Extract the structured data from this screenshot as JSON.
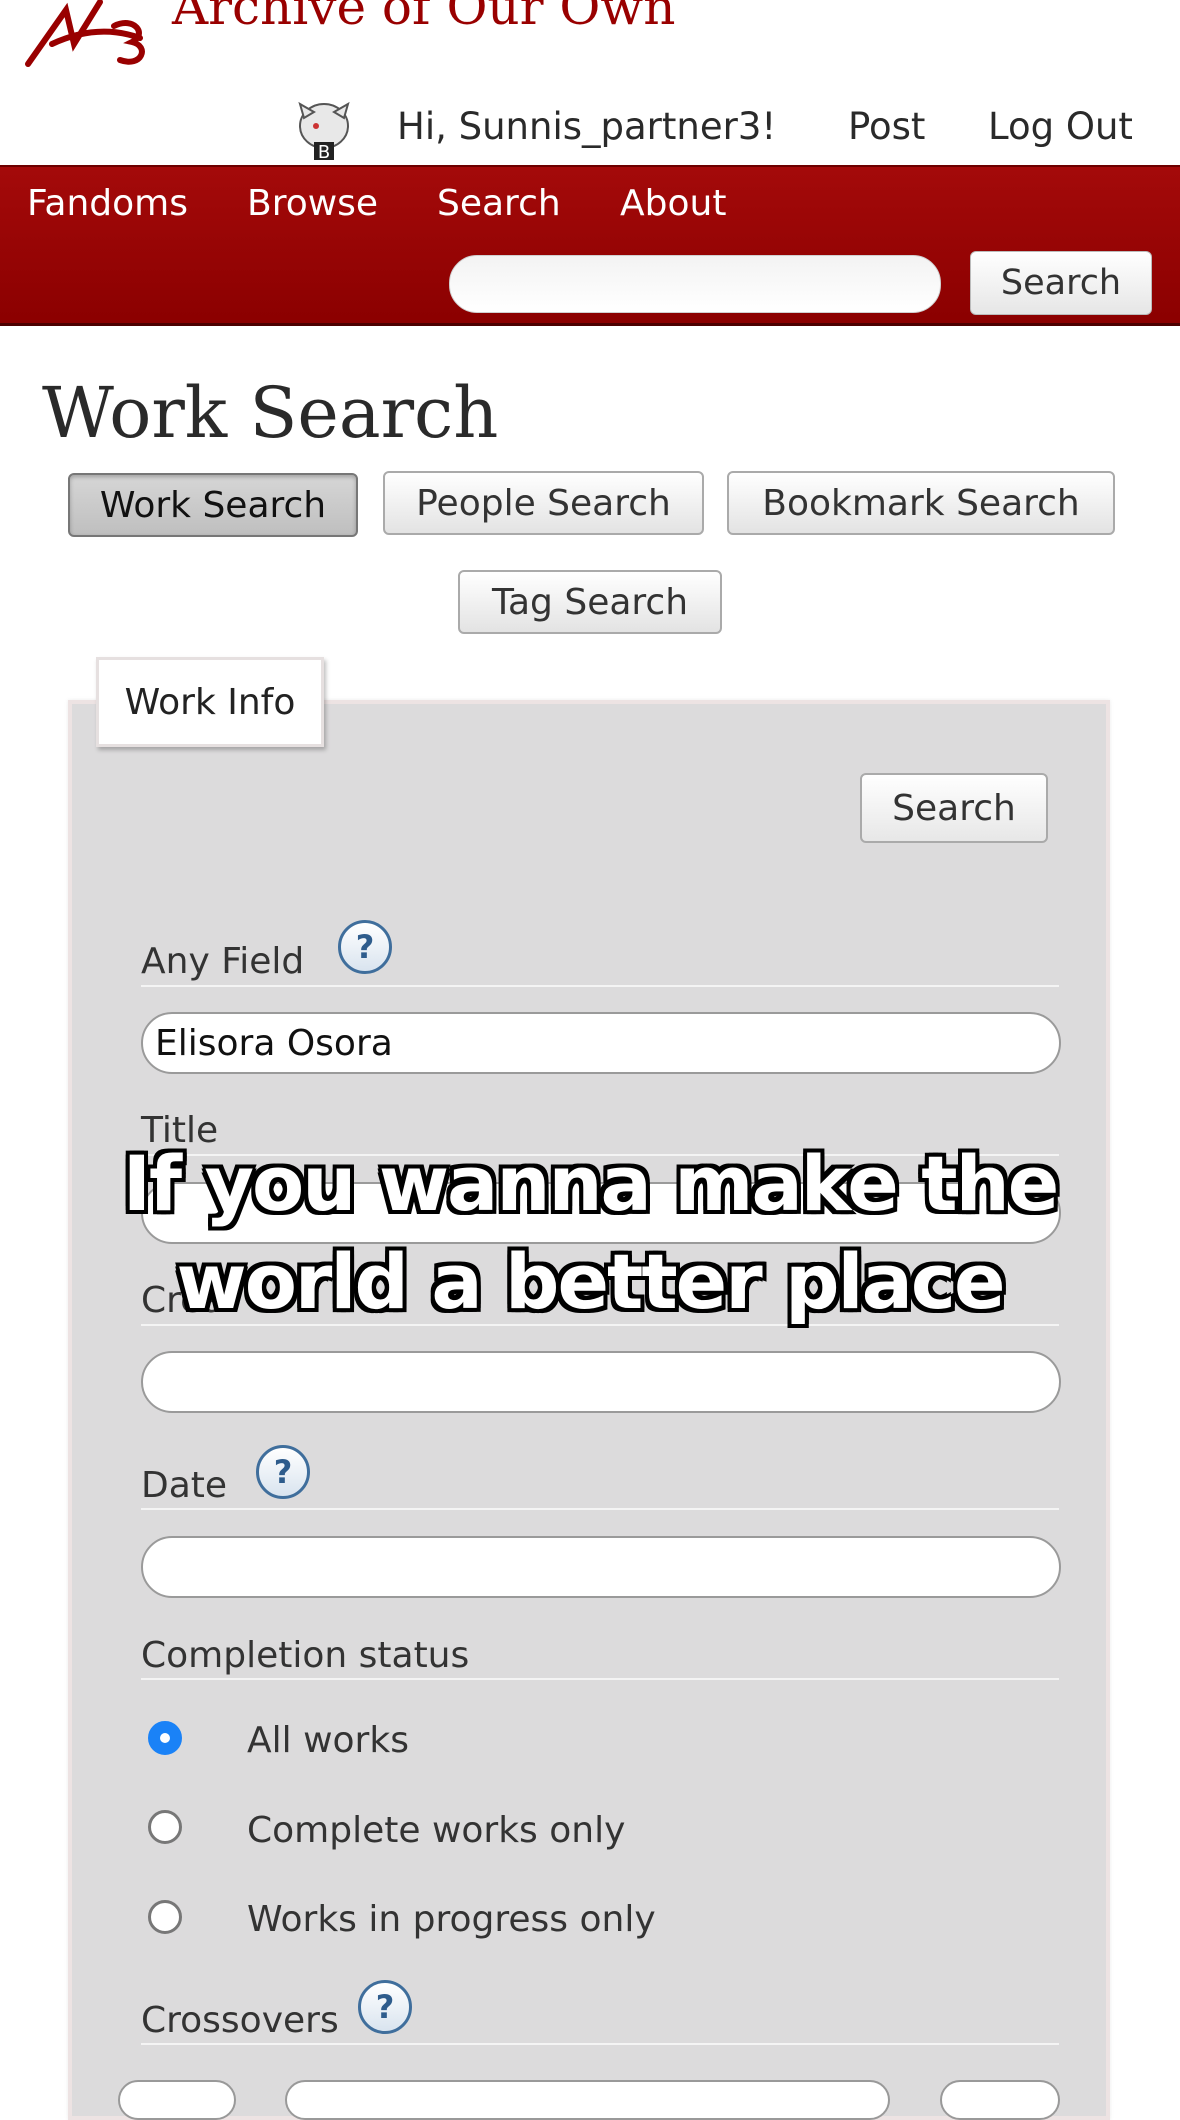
{
  "header": {
    "site_title": "Archive of Our Own",
    "greeting": "Hi, Sunnis_partner3!",
    "post": "Post",
    "log_out": "Log Out"
  },
  "nav": {
    "items": [
      "Fandoms",
      "Browse",
      "Search",
      "About"
    ],
    "search_button": "Search",
    "search_value": ""
  },
  "page": {
    "title": "Work Search",
    "tabs": [
      "Work Search",
      "People Search",
      "Bookmark Search",
      "Tag Search"
    ],
    "active_tab": "Work Search"
  },
  "form": {
    "panel_tab": "Work Info",
    "search_button": "Search",
    "any_field_label": "Any Field",
    "any_field_value": "Elisora Osora",
    "title_label": "Title",
    "title_value": "",
    "creator_label": "Crea",
    "creator_value": "",
    "date_label": "Date",
    "date_value": "",
    "completion_label": "Completion status",
    "completion_options": [
      "All works",
      "Complete works only",
      "Works in progress only"
    ],
    "completion_selected": "All works",
    "crossovers_label": "Crossovers",
    "help_glyph": "?"
  },
  "overlay": {
    "caption_line1": "If you wanna make the",
    "caption_line2": "world a better place"
  },
  "colors": {
    "brand_red": "#990000",
    "radio_selected": "#1a82f7",
    "help_icon": "#2e5c8c"
  }
}
